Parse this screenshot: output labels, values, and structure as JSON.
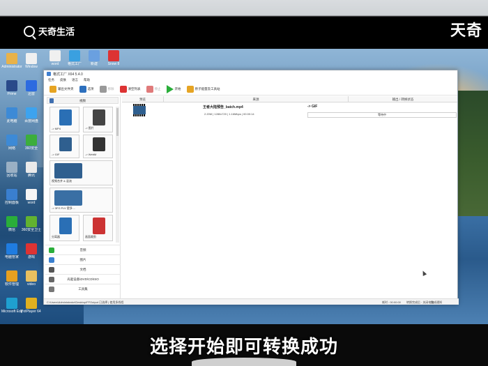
{
  "overlay": {
    "brand_left": "天奇生活",
    "brand_right": "天奇",
    "subtitle": "选择开始即可转换成功"
  },
  "desktop": {
    "icons": [
      {
        "label": "Administrator",
        "color": "#e8b24a"
      },
      {
        "label": "Prime",
        "color": "#2a4a8a"
      },
      {
        "label": "此电脑",
        "color": "#3d8ad6"
      },
      {
        "label": "网络",
        "color": "#3d8ad6"
      },
      {
        "label": "回收站",
        "color": "#9ab0c4"
      },
      {
        "label": "控制面板",
        "color": "#3a7fcf"
      },
      {
        "label": "微信",
        "color": "#2aae3a"
      },
      {
        "label": "电脑管家",
        "color": "#1f7ce0"
      },
      {
        "label": "软件管理",
        "color": "#e5a020"
      },
      {
        "label": "Microsoft Edge",
        "color": "#1f9fd0"
      }
    ],
    "icons_col2": [
      {
        "label": "Window",
        "color": "#f0f0f0"
      },
      {
        "label": "迅雷",
        "color": "#2d6be0"
      },
      {
        "label": "百度网盘",
        "color": "#3da3ef"
      },
      {
        "label": "360安全",
        "color": "#3cae3c"
      },
      {
        "label": "腾讯",
        "color": "#eaeaea"
      },
      {
        "label": "word",
        "color": "#f5f5f5"
      },
      {
        "label": "360安全卫士",
        "color": "#62b230"
      },
      {
        "label": "游戏",
        "color": "#d33"
      },
      {
        "label": "video",
        "color": "#e8c060"
      },
      {
        "label": "PotPlayer 64 bit",
        "color": "#e0b020"
      }
    ],
    "top_icons": [
      {
        "label": "word",
        "color": "#f0f0f0"
      },
      {
        "label": "格式工厂",
        "color": "#3aa0e0"
      },
      {
        "label": "新建",
        "color": "#6aa0e0"
      },
      {
        "label": "Snow 8",
        "color": "#d33"
      }
    ]
  },
  "app": {
    "title": "格式工厂  X64 5.4.0",
    "menu": [
      "任务",
      "皮肤",
      "语言",
      "帮助"
    ],
    "toolbar": [
      {
        "label": "输出文件夹",
        "color": "#e6a423",
        "disabled": false
      },
      {
        "label": "选项",
        "color": "#2c6fbd",
        "disabled": false
      },
      {
        "label": "移除",
        "color": "#999",
        "disabled": true
      },
      {
        "label": "清空列表",
        "color": "#d33",
        "disabled": false
      },
      {
        "label": "停止",
        "color": "#e07a7a",
        "disabled": true
      },
      {
        "label": "开始",
        "color": "#2aae3a",
        "disabled": false
      },
      {
        "label": "原子能量及工具站",
        "color": "#e6a423",
        "disabled": false
      }
    ],
    "sidebar_header": "视频",
    "tiles": [
      {
        "label": "-> MP4",
        "color": "#2a6fb5"
      },
      {
        "label": "-> 图片",
        "color": "#444"
      },
      {
        "label": "-> GIF",
        "color": "#2f5f8f"
      },
      {
        "label": "-> WebM",
        "color": "#333"
      },
      {
        "label": "视频合并 & 混流",
        "color": "#2f5f8f"
      },
      {
        "label": "-> 3FG  FLV  更多 ...",
        "color": "#3a6fa4"
      },
      {
        "label": "分离器",
        "color": "#2a6fb5"
      },
      {
        "label": "画面裁剪",
        "color": "#c33"
      }
    ],
    "categories": [
      {
        "label": "音频",
        "color": "#2aae3a"
      },
      {
        "label": "图片",
        "color": "#3a7fcf"
      },
      {
        "label": "文档",
        "color": "#555"
      },
      {
        "label": "光驱设备\\DVD\\CD\\ISO",
        "color": "#666"
      },
      {
        "label": "工具集",
        "color": "#777"
      }
    ],
    "columns": [
      "预览",
      "来源",
      "输出 / 转换状态"
    ],
    "task": {
      "filename": "王者大陆预告_batch.mp4",
      "meta": "2.20M | 1280x720 | 1.16Mbps | 00:00:14",
      "target": "-> GIF",
      "status": "等待中"
    },
    "statusbar": {
      "left": "C:\\Users\\Administrator\\Desktop\\FFOutput  已选择  |  使用多线程",
      "time": "耗时 : 00:00:00",
      "after": "转换完成后 : 关闭电脑",
      "notify": "完成通知"
    }
  }
}
